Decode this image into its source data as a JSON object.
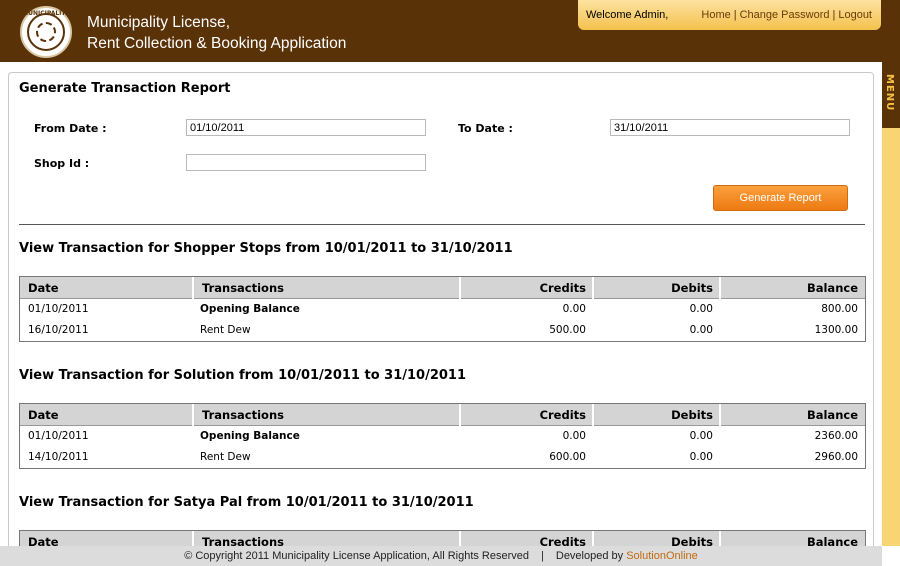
{
  "header": {
    "logo_text": "MUNICIPALITY",
    "app_title_line1": "Municipality License,",
    "app_title_line2": "Rent Collection & Booking Application",
    "welcome": "Welcome Admin,",
    "links": [
      "Home",
      "Change Password",
      "Logout"
    ]
  },
  "menu_label": "MENU",
  "form": {
    "title": "Generate Transaction Report",
    "from_label": "From Date  :",
    "from_value": "01/10/2011",
    "to_label": "To Date  :",
    "to_value": "31/10/2011",
    "shop_label": "Shop Id  :",
    "shop_value": "",
    "button": "Generate Report"
  },
  "columns": [
    "Date",
    "Transactions",
    "Credits",
    "Debits",
    "Balance"
  ],
  "reports": [
    {
      "title": "View Transaction for Shopper Stops from 10/01/2011 to 31/10/2011",
      "rows": [
        {
          "date": "01/10/2011",
          "transaction": "Opening Balance",
          "credits": "0.00",
          "debits": "0.00",
          "balance": "800.00"
        },
        {
          "date": "16/10/2011",
          "transaction": "Rent Dew",
          "credits": "500.00",
          "debits": "0.00",
          "balance": "1300.00"
        }
      ]
    },
    {
      "title": "View Transaction for Solution from 10/01/2011 to 31/10/2011",
      "rows": [
        {
          "date": "01/10/2011",
          "transaction": "Opening Balance",
          "credits": "0.00",
          "debits": "0.00",
          "balance": "2360.00"
        },
        {
          "date": "14/10/2011",
          "transaction": "Rent Dew",
          "credits": "600.00",
          "debits": "0.00",
          "balance": "2960.00"
        }
      ]
    },
    {
      "title": "View Transaction for Satya Pal from 10/01/2011 to 31/10/2011",
      "rows": []
    }
  ],
  "footer": {
    "copyright": "© Copyright 2011 Municipality License Application, All Rights Reserved",
    "separator": "|",
    "developed_by": "Developed by",
    "brand": "SolutionOnline"
  },
  "colors": {
    "header_brown": "#5a3208",
    "accent_orange": "#ed7a12",
    "menu_yellow": "#f8d572"
  }
}
